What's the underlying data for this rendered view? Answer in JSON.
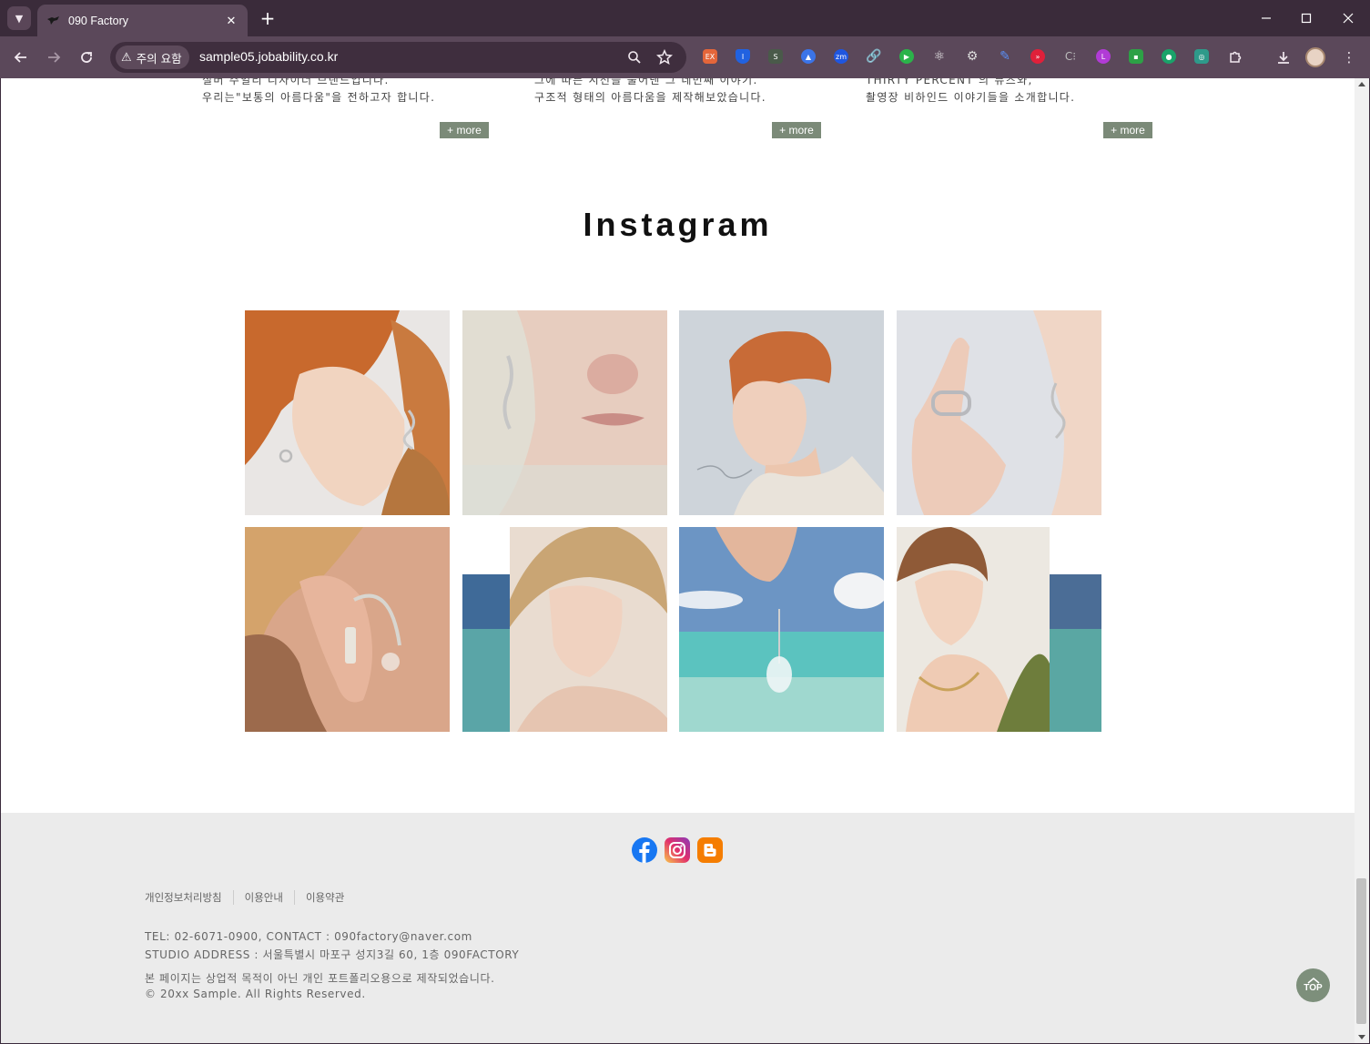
{
  "browser": {
    "tab_title": "090 Factory",
    "security_chip": "주의 요함",
    "url": "sample05.jobability.co.kr",
    "new_tab": "+",
    "tab_close": "✕",
    "top_label": "TOP"
  },
  "intro_columns": [
    {
      "line1": "실버 주얼리 디자이너 브랜드입니다.",
      "line2": "우리는\"보통의 아름다움\"을 전하고자 합니다.",
      "more": "+ more"
    },
    {
      "line1": "그에 따른 시선을 풀어낸 그 네번째 이야기.",
      "line2": "구조적 형태의 아름다움을 제작해보았습니다.",
      "more": "+ more"
    },
    {
      "line1": "THIRTY PERCENT 의 뮤즈와,",
      "line2": "촬영장 비하인드 이야기들을 소개합니다.",
      "more": "+ more"
    }
  ],
  "instagram": {
    "title": "Instagram",
    "photos": [
      {
        "icon": "photo-red-hair-earring"
      },
      {
        "icon": "photo-face-closeup"
      },
      {
        "icon": "photo-profile-portrait"
      },
      {
        "icon": "photo-hand-ring"
      },
      {
        "icon": "photo-straw-hat-earring"
      },
      {
        "icon": "photo-hat-portrait-sea"
      },
      {
        "icon": "photo-pendant-sea"
      },
      {
        "icon": "photo-necklace-leaf"
      }
    ]
  },
  "footer": {
    "sns": [
      "facebook-icon",
      "instagram-icon",
      "blogger-icon"
    ],
    "links": [
      "개인정보처리방침",
      "이용안내",
      "이용약관"
    ],
    "tel_line": "TEL: 02-6071-0900, CONTACT : 090factory@naver.com",
    "address_line": "STUDIO ADDRESS : 서울특별시 마포구 성지3길 60, 1층 090FACTORY",
    "notice_line": "본 페이지는 상업적 목적이 아닌 개인 포트폴리오용으로 제작되었습니다.",
    "copyright_line": "© 20xx Sample. All Rights Reserved."
  }
}
